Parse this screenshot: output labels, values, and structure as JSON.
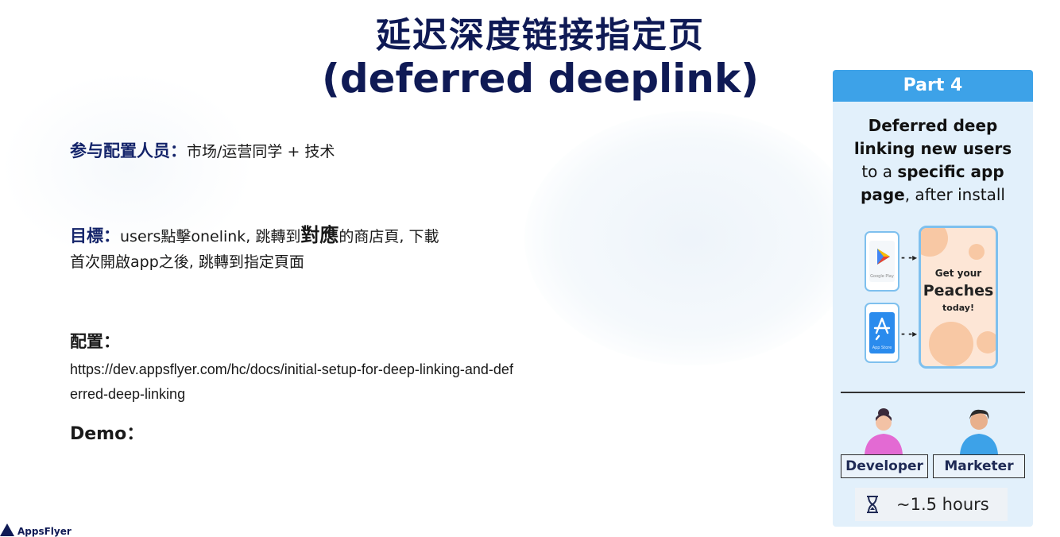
{
  "title_line1": "延迟深度链接指定页",
  "title_line2": "(deferred deeplink)",
  "participants": {
    "label": "参与配置人员：",
    "value": "市场/运营同学 + 技术"
  },
  "goal": {
    "label": "目標：",
    "line1_pre": "users點擊onelink, 跳轉到",
    "line1_emph": "對應",
    "line1_post": "的商店頁, 下載",
    "line2": "首次開啟app之後, 跳轉到指定頁面"
  },
  "config": {
    "label": "配置：",
    "url": "https://dev.appsflyer.com/hc/docs/initial-setup-for-deep-linking-and-deferred-deep-linking"
  },
  "demo": {
    "label": "Demo："
  },
  "card": {
    "part": "Part 4",
    "desc_bold1": "Deferred deep",
    "desc_bold2": "linking new users",
    "desc_plain1": "to a ",
    "desc_bold3": "specific app",
    "desc_bold4": "page",
    "desc_plain2": ", after install",
    "google_play_label": "Google Play",
    "app_store_label": "App Store",
    "phone_line1": "Get your",
    "phone_line2": "Peaches",
    "phone_line3": "today!",
    "role1": "Developer",
    "role2": "Marketer",
    "time": "~1.5 hours",
    "hourglass_icon": "hourglass-icon",
    "accent": "#3da2e8",
    "background": "#e2f0fb"
  },
  "footer_logo_text": "AppsFlyer"
}
